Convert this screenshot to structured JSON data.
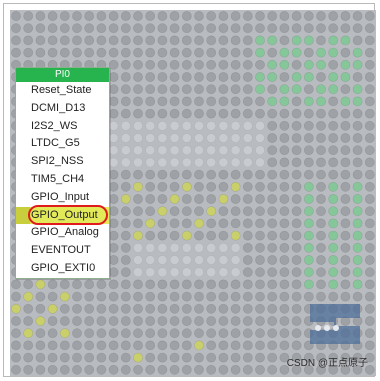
{
  "menu": {
    "header": "PI0",
    "items": [
      {
        "label": "Reset_State",
        "selected": false
      },
      {
        "label": "DCMI_D13",
        "selected": false
      },
      {
        "label": "I2S2_WS",
        "selected": false
      },
      {
        "label": "LTDC_G5",
        "selected": false
      },
      {
        "label": "SPI2_NSS",
        "selected": false
      },
      {
        "label": "TIM5_CH4",
        "selected": false
      },
      {
        "label": "GPIO_Input",
        "selected": false
      },
      {
        "label": "GPIO_Output",
        "selected": true
      },
      {
        "label": "GPIO_Analog",
        "selected": false
      },
      {
        "label": "EVENTOUT",
        "selected": false
      },
      {
        "label": "GPIO_EXTI0",
        "selected": false
      }
    ]
  },
  "watermark": "CSDN @正点原子",
  "colors": {
    "board_bg": "#b8bbbf",
    "pin_default": "#9ea1a5",
    "pin_green": "#86c79a",
    "pin_yellow": "#c9cf6a",
    "menu_header": "#27b44e",
    "menu_selected": "#e3ea59",
    "highlight_ring": "#e01b1b"
  },
  "icons": {
    "logo": "board-logo-icon"
  }
}
